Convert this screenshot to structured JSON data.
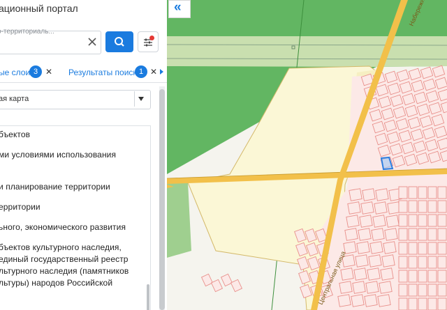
{
  "panel": {
    "title": "ационный портал",
    "search": {
      "placeholder": "о-территориаль..."
    },
    "tabs": [
      {
        "label": "ые слои",
        "count": "3"
      },
      {
        "label": "Результаты поиска",
        "count": "1"
      }
    ],
    "basemap_select": "ая карта",
    "layer_items": [
      "бъектов",
      "ми условиями использования",
      "и планирование территории",
      "ерритории",
      "ьного, экономического развития",
      "бъектов культурного наследия,",
      "единый государственный реестр",
      "льтурного наследия (памятников",
      "льтуры) народов Российской"
    ]
  },
  "map": {
    "collapse_glyph": "«",
    "street_labels": [
      "Центральная улица",
      "Набережная"
    ],
    "colors": {
      "forest": "#62b662",
      "meadow": "#c9dfaf",
      "zone_yellow": "#fbf7d6",
      "parcel_fill": "#fce9e7",
      "parcel_border": "#e88f8a",
      "road": "#f2c04a",
      "highlight": "#2e7fe0"
    }
  },
  "icons": {
    "search": "search-icon",
    "clear": "close-icon",
    "filter": "filter-sliders-icon",
    "collapse": "double-chevron-left-icon"
  }
}
